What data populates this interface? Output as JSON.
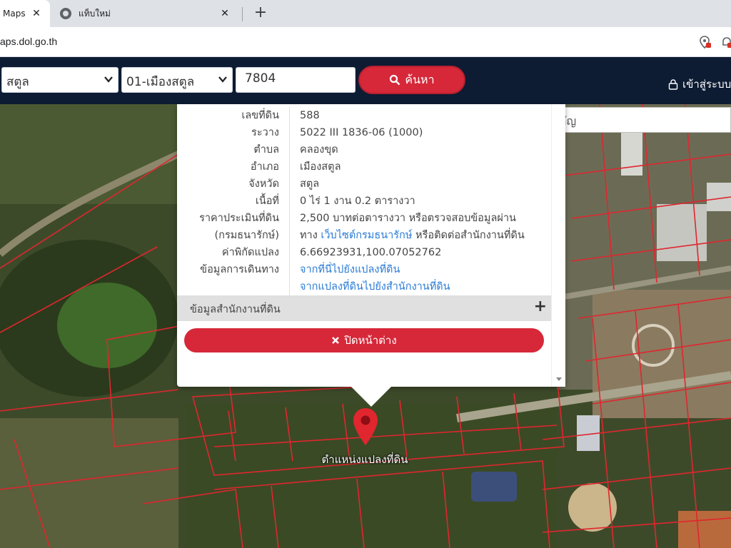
{
  "browser": {
    "active_tab": {
      "title": "Maps",
      "close": "✕"
    },
    "inactive_tab": {
      "title": "แท็บใหม่",
      "close": "✕"
    },
    "new_tab": "+",
    "url": "aps.dol.go.th"
  },
  "search": {
    "province": "สตูล",
    "district": "01-เมืองสตูล",
    "parcel_number": "7804",
    "button_label": "ค้นหา",
    "login_label": "เข้าสู่ระบบ"
  },
  "map": {
    "place_search_placeholder": "ค้นหาสถานที่สำคัญ",
    "marker_label": "ตำแหน่งแปลงที่ดิน"
  },
  "parcel": {
    "rows": [
      {
        "label": "เลขที่ดิน",
        "value": "588"
      },
      {
        "label": "ระวาง",
        "value": "5022 III 1836-06 (1000)"
      },
      {
        "label": "ตำบล",
        "value": "คลองขุด"
      },
      {
        "label": "อำเภอ",
        "value": "เมืองสตูล"
      },
      {
        "label": "จังหวัด",
        "value": "สตูล"
      },
      {
        "label": "เนื้อที่",
        "value": "0 ไร่ 1 งาน 0.2 ตารางวา"
      }
    ],
    "price": {
      "label1": "ราคาประเมินที่ดิน",
      "label2": "(กรมธนารักษ์)",
      "line1": "2,500 บาทต่อตารางวา หรือตรวจสอบข้อมูลผ่าน",
      "line2_prefix": "ทาง",
      "line2_link": "เว็บไซต์กรมธนารักษ์",
      "line2_suffix": "หรือติดต่อสำนักงานที่ดิน"
    },
    "coordinates": {
      "label": "ค่าพิกัดแปลง",
      "value": "6.66923931,100.07052762"
    },
    "directions": {
      "label": "ข้อมูลการเดินทาง",
      "link1": "จากที่นี่ไปยังแปลงที่ดิน",
      "link2": "จากแปลงที่ดินไปยังสำนักงานที่ดิน"
    },
    "office_section": "ข้อมูลสำนักงานที่ดิน",
    "office_expand": "+",
    "close_button": "ปิดหน้าต่าง"
  },
  "colors": {
    "accent_red": "#d62839",
    "header_navy": "#0d1b33",
    "link_blue": "#2a7bd6",
    "parcel_line": "#e0262e"
  },
  "icons": [
    "chrome-icon",
    "close-icon",
    "plus-icon",
    "chevron-down-icon",
    "search-icon",
    "lock-icon",
    "times-icon",
    "map-pin-icon"
  ]
}
